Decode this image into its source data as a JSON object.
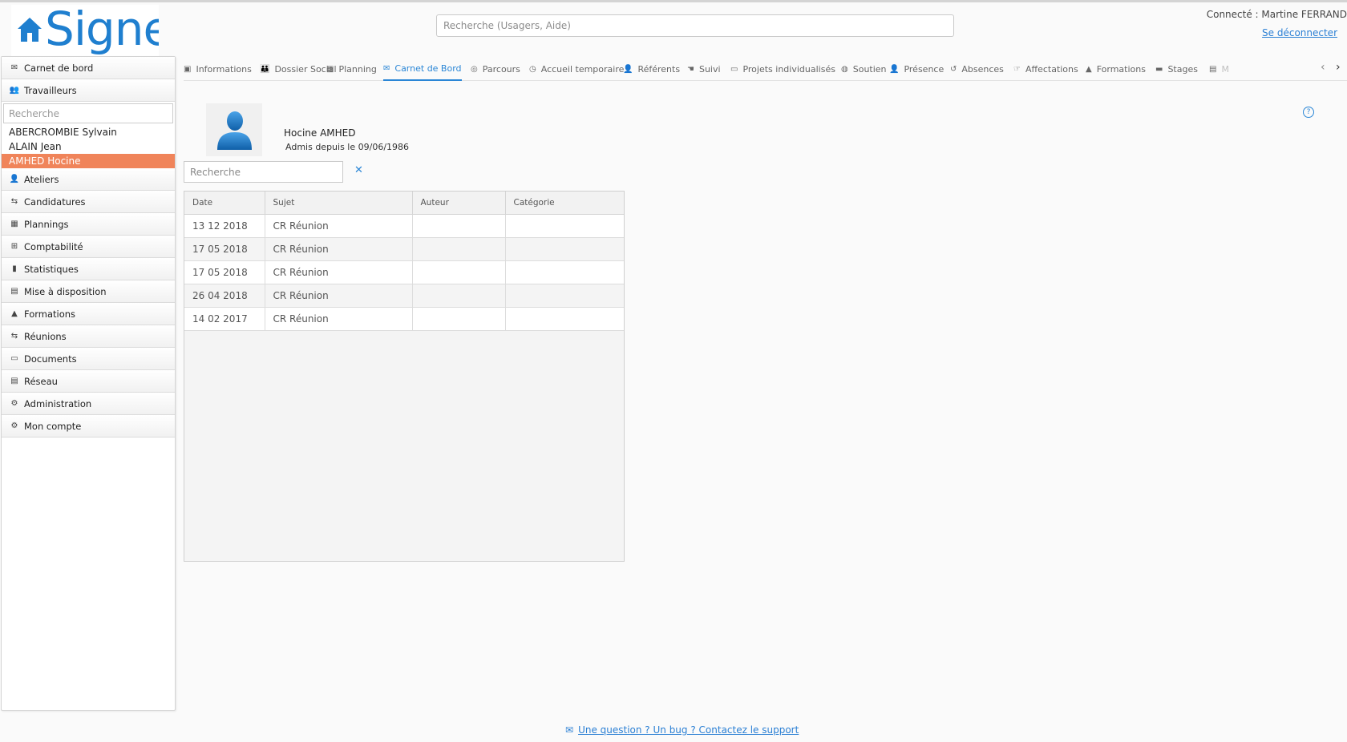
{
  "header": {
    "logo_text": "Signe",
    "search_placeholder": "Recherche (Usagers, Aide)",
    "connected_text": "Connecté : Martine FERRAND",
    "logout_label": "Se déconnecter"
  },
  "sidebar": {
    "items_top": [
      {
        "label": "Carnet de bord",
        "icon": "envelope-icon",
        "glyph": "✉"
      },
      {
        "label": "Travailleurs",
        "icon": "users-icon",
        "glyph": "👥"
      }
    ],
    "search_placeholder": "Recherche",
    "workers": [
      "ABERCROMBIE Sylvain",
      "ALAIN Jean",
      "AMHED Hocine"
    ],
    "selected_worker": "AMHED Hocine",
    "items_bottom": [
      {
        "label": "Ateliers",
        "icon": "user-icon",
        "glyph": "👤"
      },
      {
        "label": "Candidatures",
        "icon": "handshake-icon",
        "glyph": "⇆"
      },
      {
        "label": "Plannings",
        "icon": "calendar-icon",
        "glyph": "▦"
      },
      {
        "label": "Comptabilité",
        "icon": "calculator-icon",
        "glyph": "⊞"
      },
      {
        "label": "Statistiques",
        "icon": "bar-chart-icon",
        "glyph": "▮"
      },
      {
        "label": "Mise à disposition",
        "icon": "building-icon",
        "glyph": "▤"
      },
      {
        "label": "Formations",
        "icon": "graduation-cap-icon",
        "glyph": "▲"
      },
      {
        "label": "Réunions",
        "icon": "handshake-icon",
        "glyph": "⇆"
      },
      {
        "label": "Documents",
        "icon": "book-icon",
        "glyph": "▭"
      },
      {
        "label": "Réseau",
        "icon": "building-icon",
        "glyph": "▤"
      },
      {
        "label": "Administration",
        "icon": "cogs-icon",
        "glyph": "⚙"
      },
      {
        "label": "Mon compte",
        "icon": "gear-icon",
        "glyph": "⚙"
      }
    ]
  },
  "tabs": [
    {
      "label": "Informations",
      "icon": "id-card-icon",
      "glyph": "▣"
    },
    {
      "label": "Dossier Social",
      "icon": "family-icon",
      "glyph": "👪"
    },
    {
      "label": "Planning",
      "icon": "calendar-icon",
      "glyph": "▦"
    },
    {
      "label": "Carnet de Bord",
      "icon": "envelope-icon",
      "glyph": "✉"
    },
    {
      "label": "Parcours",
      "icon": "compass-icon",
      "glyph": "◎"
    },
    {
      "label": "Accueil temporaire",
      "icon": "clock-icon",
      "glyph": "◷"
    },
    {
      "label": "Référents",
      "icon": "user-tie-icon",
      "glyph": "👤"
    },
    {
      "label": "Suivi",
      "icon": "hands-icon",
      "glyph": "☚"
    },
    {
      "label": "Projets individualisés",
      "icon": "book-icon",
      "glyph": "▭"
    },
    {
      "label": "Soutien",
      "icon": "life-ring-icon",
      "glyph": "◍"
    },
    {
      "label": "Présence",
      "icon": "user-check-icon",
      "glyph": "👤"
    },
    {
      "label": "Absences",
      "icon": "history-icon",
      "glyph": "↺"
    },
    {
      "label": "Affectations",
      "icon": "hand-icon",
      "glyph": "☞"
    },
    {
      "label": "Formations",
      "icon": "graduation-cap-icon",
      "glyph": "▲"
    },
    {
      "label": "Stages",
      "icon": "briefcase-icon",
      "glyph": "▬"
    },
    {
      "label": "M",
      "icon": "building-icon",
      "glyph": "▤"
    }
  ],
  "active_tab": "Carnet de Bord",
  "profile": {
    "name": "Hocine AMHED",
    "admission": "Admis depuis le 09/06/1986"
  },
  "notes": {
    "search_placeholder": "Recherche",
    "columns": [
      "Date",
      "Sujet",
      "Auteur",
      "Catégorie"
    ],
    "rows": [
      [
        "13 12 2018",
        "CR Réunion",
        "",
        ""
      ],
      [
        "17 05 2018",
        "CR Réunion",
        "",
        ""
      ],
      [
        "17 05 2018",
        "CR Réunion",
        "",
        ""
      ],
      [
        "26 04 2018",
        "CR Réunion",
        "",
        ""
      ],
      [
        "14 02 2017",
        "CR Réunion",
        "",
        ""
      ]
    ]
  },
  "footer": {
    "support_link": "Une question ? Un bug ? Contactez le support"
  },
  "colors": {
    "accent": "#2a86d6",
    "selected_row": "#f0845a",
    "logo_blue": "#1f7fcf"
  }
}
